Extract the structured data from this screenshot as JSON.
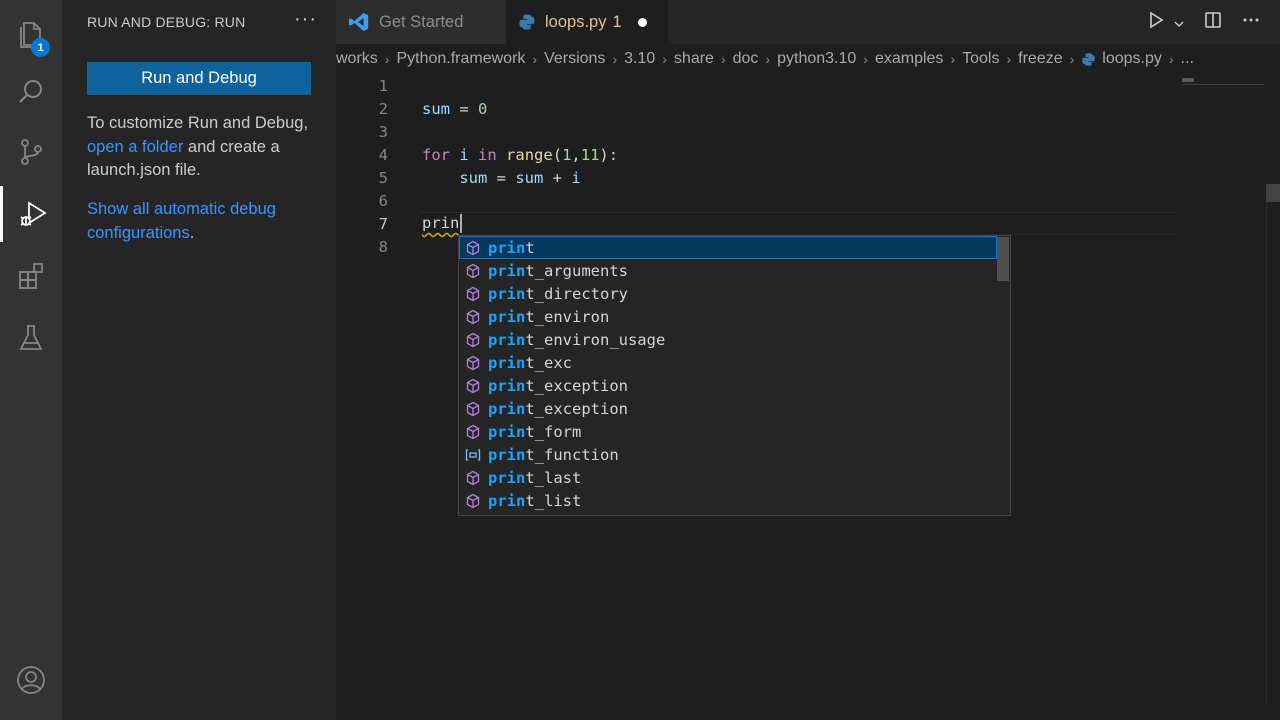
{
  "activity_bar": {
    "explorer_badge": "1",
    "items": [
      {
        "name": "explorer-icon"
      },
      {
        "name": "search-icon"
      },
      {
        "name": "source-control-icon"
      },
      {
        "name": "run-debug-icon",
        "active": true
      },
      {
        "name": "extensions-icon"
      },
      {
        "name": "testing-icon"
      },
      {
        "name": "account-icon"
      }
    ]
  },
  "sidebar": {
    "title": "RUN AND DEBUG: RUN",
    "more": "···",
    "run_button": "Run and Debug",
    "text_before_link": "To customize Run and Debug, ",
    "link": "open a folder",
    "text_after_link": " and create a launch.json file.",
    "show_all_link": "Show all automatic debug configurations",
    "show_all_suffix": "."
  },
  "tabs": [
    {
      "label": "Get Started",
      "icon": "vscode-logo-icon",
      "active": false
    },
    {
      "label": "loops.py",
      "icon": "python-icon",
      "active": true,
      "problems": "1",
      "dirty": true
    }
  ],
  "breadcrumb": [
    "works",
    "Python.framework",
    "Versions",
    "3.10",
    "share",
    "doc",
    "python3.10",
    "examples",
    "Tools",
    "freeze",
    "loops.py",
    "..."
  ],
  "editor": {
    "line_numbers": [
      "1",
      "2",
      "3",
      "4",
      "5",
      "6",
      "7",
      "8"
    ],
    "active_line": "7",
    "lines": [
      "",
      "sum = 0",
      "",
      "for i in range(1,11):",
      "    sum = sum + i",
      "",
      "prin",
      ""
    ]
  },
  "suggestions": {
    "prefix": "prin",
    "items": [
      {
        "label": "print",
        "suffix": "t",
        "kind": "module-icon",
        "selected": true
      },
      {
        "label": "print_arguments",
        "suffix": "t_arguments",
        "kind": "module-icon"
      },
      {
        "label": "print_directory",
        "suffix": "t_directory",
        "kind": "module-icon"
      },
      {
        "label": "print_environ",
        "suffix": "t_environ",
        "kind": "module-icon"
      },
      {
        "label": "print_environ_usage",
        "suffix": "t_environ_usage",
        "kind": "module-icon"
      },
      {
        "label": "print_exc",
        "suffix": "t_exc",
        "kind": "module-icon"
      },
      {
        "label": "print_exception",
        "suffix": "t_exception",
        "kind": "module-icon"
      },
      {
        "label": "print_exception",
        "suffix": "t_exception",
        "kind": "module-icon"
      },
      {
        "label": "print_form",
        "suffix": "t_form",
        "kind": "module-icon"
      },
      {
        "label": "print_function",
        "suffix": "t_function",
        "kind": "variable-icon"
      },
      {
        "label": "print_last",
        "suffix": "t_last",
        "kind": "module-icon"
      },
      {
        "label": "print_list",
        "suffix": "t_list",
        "kind": "module-icon"
      }
    ]
  },
  "colors": {
    "accent": "#0e639c",
    "link": "#3794ff",
    "match": "#18a3ff",
    "modified_tab": "#e2c08d"
  }
}
